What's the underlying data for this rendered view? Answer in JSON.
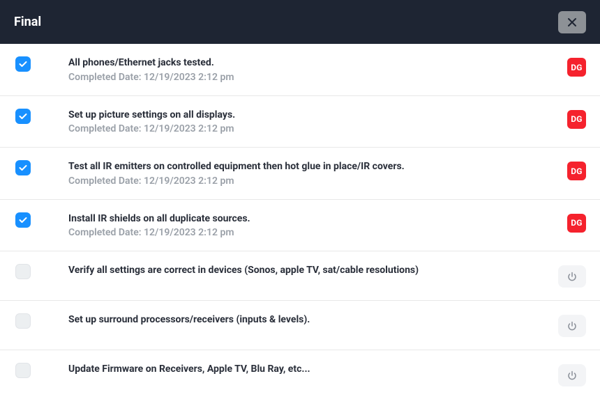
{
  "header": {
    "title": "Final"
  },
  "tasks": [
    {
      "checked": true,
      "title": "All phones/Ethernet jacks tested.",
      "completed": "Completed Date: 12/19/2023 2:12 pm",
      "badge_type": "user",
      "badge_text": "DG"
    },
    {
      "checked": true,
      "title": "Set up picture settings on all displays.",
      "completed": "Completed Date: 12/19/2023 2:12 pm",
      "badge_type": "user",
      "badge_text": "DG"
    },
    {
      "checked": true,
      "title": "Test all IR emitters on controlled equipment then hot glue in place/IR covers.",
      "completed": "Completed Date: 12/19/2023 2:12 pm",
      "badge_type": "user",
      "badge_text": "DG"
    },
    {
      "checked": true,
      "title": "Install IR shields on all duplicate sources.",
      "completed": "Completed Date: 12/19/2023 2:12 pm",
      "badge_type": "user",
      "badge_text": "DG"
    },
    {
      "checked": false,
      "title": "Verify all settings are correct in devices (Sonos, apple TV, sat/cable resolutions)",
      "completed": "",
      "badge_type": "power",
      "badge_text": ""
    },
    {
      "checked": false,
      "title": "Set up surround processors/receivers (inputs & levels).",
      "completed": "",
      "badge_type": "power",
      "badge_text": ""
    },
    {
      "checked": false,
      "title": "Update Firmware on Receivers, Apple TV, Blu Ray, etc...",
      "completed": "",
      "badge_type": "power",
      "badge_text": ""
    }
  ]
}
